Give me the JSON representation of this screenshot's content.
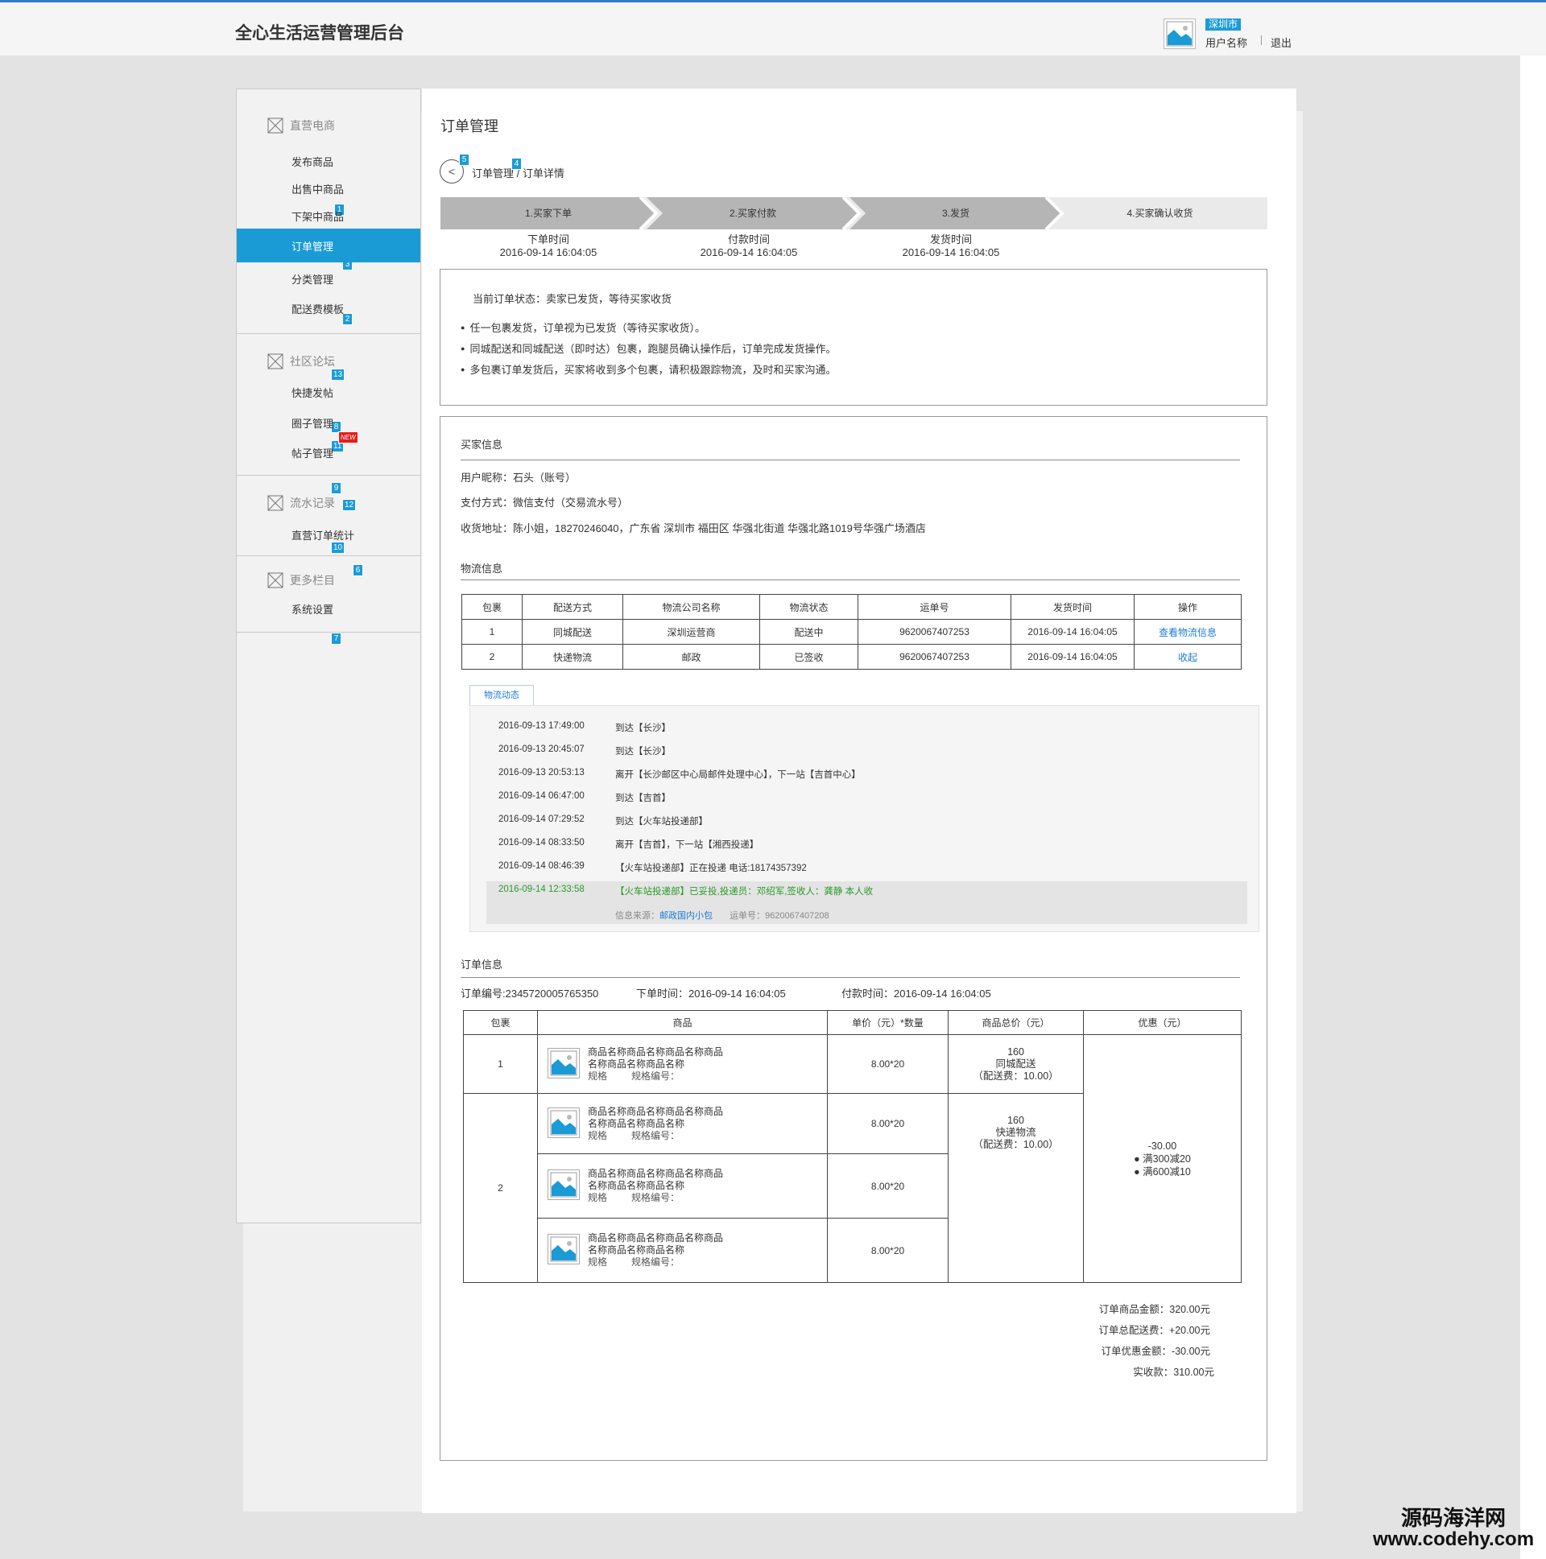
{
  "header": {
    "app_title": "全心生活运营管理后台",
    "city": "深圳市",
    "user_name": "用户名称",
    "logout": "退出"
  },
  "sidebar": {
    "groups": [
      {
        "title": "直营电商",
        "items": [
          {
            "label": "发布商品",
            "badge": "1"
          },
          {
            "label": "出售中商品",
            "badge": "3"
          },
          {
            "label": "下架中商品",
            "badge": "2"
          },
          {
            "label": "订单管理",
            "badge": "13",
            "active": true
          },
          {
            "label": "分类管理",
            "badge": "11"
          },
          {
            "label": "配送费模板",
            "badge": "12"
          }
        ]
      },
      {
        "title": "社区论坛",
        "items": [
          {
            "label": "快捷发帖",
            "badge": "8",
            "new_badge": "NEW"
          },
          {
            "label": "圈子管理",
            "badge": "9"
          },
          {
            "label": "帖子管理",
            "badge": "10"
          }
        ]
      },
      {
        "title": "流水记录",
        "items": [
          {
            "label": "直营订单统计",
            "badge": "6"
          }
        ]
      },
      {
        "title": "更多栏目",
        "items": [
          {
            "label": "系统设置",
            "badge": "7"
          }
        ]
      }
    ]
  },
  "main": {
    "title": "订单管理",
    "back_icon": "chevron-left-icon",
    "breadcrumb": {
      "parent": "订单管理",
      "sep": "/",
      "current": "订单详情",
      "badge_back": "5",
      "badge_parent": "4"
    },
    "steps": [
      {
        "label": "1.买家下单",
        "time_label": "下单时间",
        "time": "2016-09-14 16:04:05"
      },
      {
        "label": "2.买家付款",
        "time_label": "付款时间",
        "time": "2016-09-14 16:04:05"
      },
      {
        "label": "3.发货",
        "time_label": "发货时间",
        "time": "2016-09-14 16:04:05"
      },
      {
        "label": "4.买家确认收货",
        "time_label": "",
        "time": ""
      }
    ],
    "status": {
      "current": "当前订单状态：卖家已发货，等待买家收货",
      "bullets": [
        "任一包裹发货，订单视为已发货（等待买家收货）。",
        "同城配送和同城配送（即时达）包裹，跑腿员确认操作后，订单完成发货操作。",
        "多包裹订单发货后，买家将收到多个包裹，请积极跟踪物流，及时和买家沟通。"
      ]
    },
    "buyer": {
      "title": "买家信息",
      "nickname": "用户昵称：石头（账号）",
      "payment": "支付方式：微信支付（交易流水号）",
      "address": "收货地址：陈小姐，18270246040，广东省 深圳市 福田区 华强北街道 华强北路1019号华强广场酒店"
    },
    "logistics": {
      "title": "物流信息",
      "headers": [
        "包裹",
        "配送方式",
        "物流公司名称",
        "物流状态",
        "运单号",
        "发货时间",
        "操作"
      ],
      "rows": [
        {
          "pkg": "1",
          "method": "同城配送",
          "company": "深圳运营商",
          "status": "配送中",
          "waybill": "9620067407253",
          "time": "2016-09-14 16:04:05",
          "action": "查看物流信息"
        },
        {
          "pkg": "2",
          "method": "快递物流",
          "company": "邮政",
          "status": "已签收",
          "waybill": "9620067407253",
          "time": "2016-09-14 16:04:05",
          "action": "收起"
        }
      ],
      "tab": "物流动态",
      "tracking": [
        {
          "time": "2016-09-13 17:49:00",
          "text": "到达【长沙】"
        },
        {
          "time": "2016-09-13 20:45:07",
          "text": "到达【长沙】"
        },
        {
          "time": "2016-09-13 20:53:13",
          "text": "离开【长沙邮区中心局邮件处理中心】，下一站【吉首中心】"
        },
        {
          "time": "2016-09-14 06:47:00",
          "text": "到达【吉首】"
        },
        {
          "time": "2016-09-14 07:29:52",
          "text": "到达【火车站投递部】"
        },
        {
          "time": "2016-09-14 08:33:50",
          "text": "离开【吉首】，下一站【湘西投递】"
        },
        {
          "time": "2016-09-14 08:46:39",
          "text": "【火车站投递部】正在投递 电话:18174357392"
        },
        {
          "time": "2016-09-14 12:33:58",
          "text": "【火车站投递部】已妥投,投递员：邓绍军,签收人：龚静 本人收"
        }
      ],
      "source_label": "信息来源：",
      "source_link": "邮政国内小包",
      "source_waybill": "运单号：9620067407208"
    },
    "order": {
      "title": "订单信息",
      "order_no": "订单编号:2345720005765350",
      "order_time": "下单时间：2016-09-14 16:04:05",
      "pay_time": "付款时间：2016-09-14 16:04:05",
      "headers": [
        "包裹",
        "商品",
        "单价（元）*数量",
        "商品总价（元）",
        "优惠（元）"
      ],
      "product_name_1": "商品名称商品名称商品名称商品",
      "product_name_2": "名称商品名称商品名称",
      "spec": "规格",
      "spec_no": "规格编号：",
      "price_qty": "8.00*20",
      "pkg1": {
        "no": "1",
        "total": "160",
        "method": "同城配送",
        "fee": "（配送费：10.00）"
      },
      "pkg2": {
        "no": "2",
        "total": "160",
        "method": "快递物流",
        "fee": "（配送费：10.00）"
      },
      "discount": {
        "amount": "-30.00",
        "rules": [
          "满300减20",
          "满600减10"
        ]
      }
    },
    "summary": [
      {
        "label": "订单商品金额：",
        "value": "320.00元"
      },
      {
        "label": "订单总配送费：",
        "value": "+20.00元"
      },
      {
        "label": "订单优惠金额：",
        "value": "-30.00元"
      },
      {
        "label": "实收款：",
        "value": "310.00元"
      }
    ]
  },
  "watermark": {
    "line1": "源码海洋网",
    "line2": "www.codehy.com"
  }
}
